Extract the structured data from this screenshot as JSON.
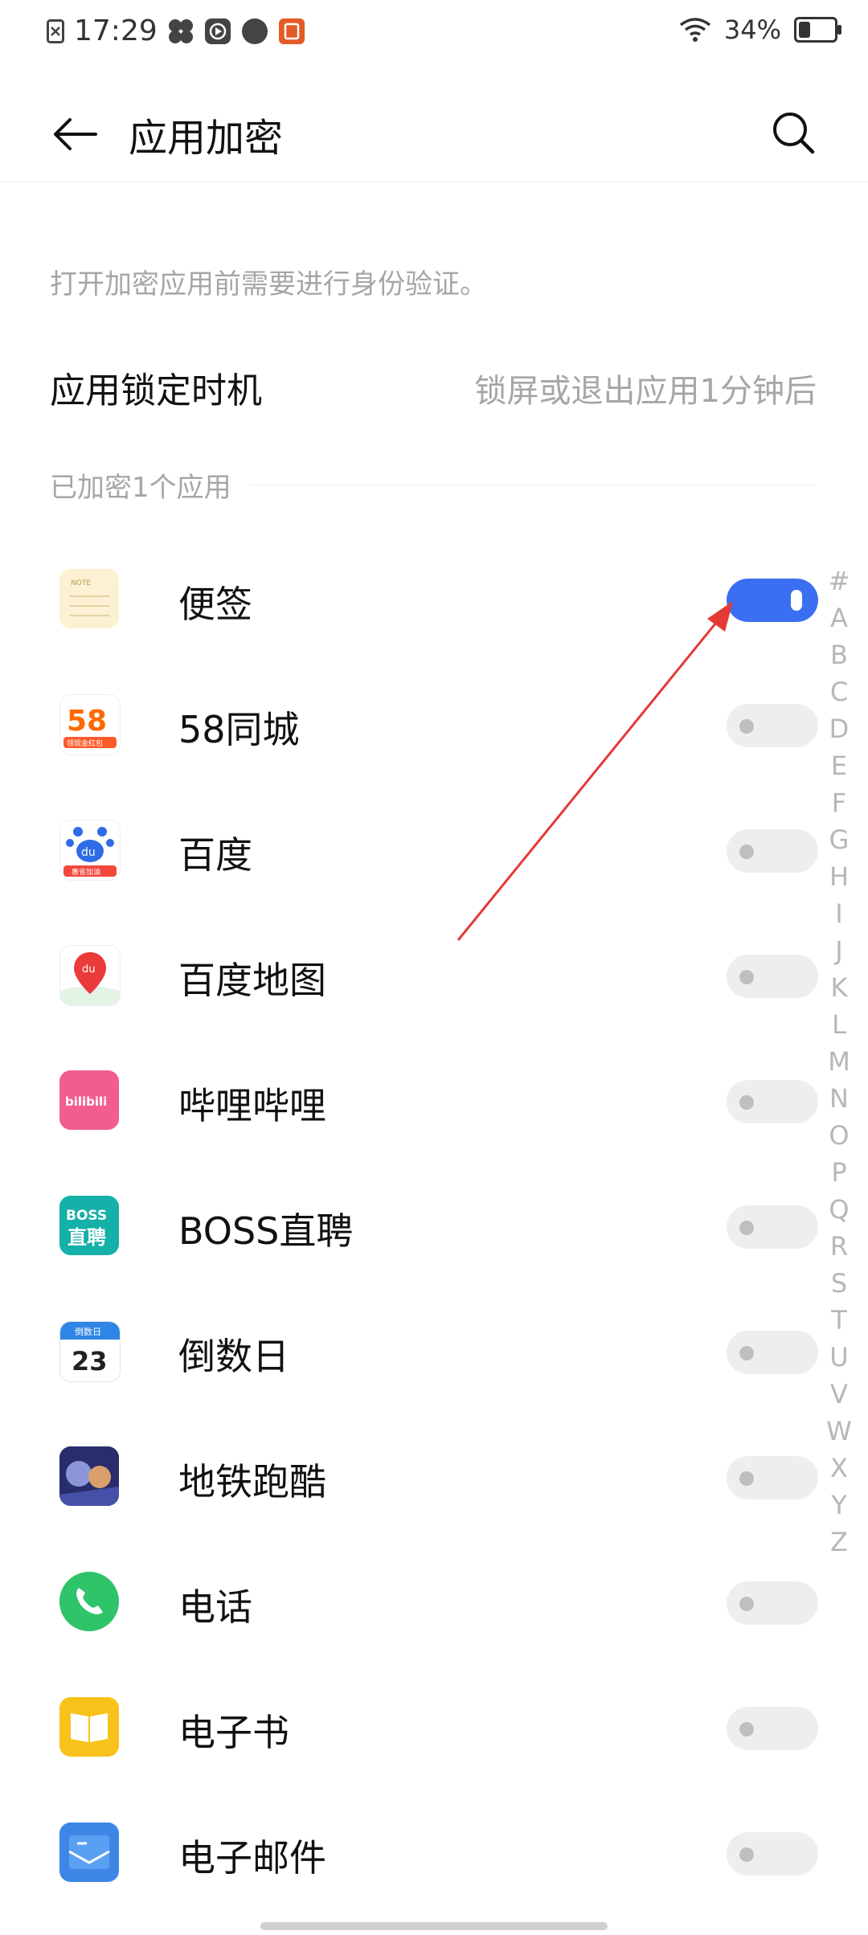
{
  "status_bar": {
    "time": "17:29",
    "battery": "34%",
    "battery_level": 0.34,
    "icons": [
      "sim-icon",
      "pinwheel-icon",
      "video-icon",
      "compass-icon",
      "orange-app-icon",
      "wifi-icon"
    ]
  },
  "header": {
    "title": "应用加密"
  },
  "description": "打开加密应用前需要进行身份验证。",
  "lock_setting": {
    "label": "应用锁定时机",
    "value": "锁屏或退出应用1分钟后"
  },
  "section": {
    "title": "已加密1个应用"
  },
  "apps": [
    {
      "name": "便签",
      "enabled": true,
      "icon": "note-icon"
    },
    {
      "name": "58同城",
      "enabled": false,
      "icon": "58-icon"
    },
    {
      "name": "百度",
      "enabled": false,
      "icon": "baidu-icon"
    },
    {
      "name": "百度地图",
      "enabled": false,
      "icon": "baidu-map-icon"
    },
    {
      "name": "哔哩哔哩",
      "enabled": false,
      "icon": "bilibili-icon"
    },
    {
      "name": "BOSS直聘",
      "enabled": false,
      "icon": "boss-icon"
    },
    {
      "name": "倒数日",
      "enabled": false,
      "icon": "countdown-icon"
    },
    {
      "name": "地铁跑酷",
      "enabled": false,
      "icon": "subway-surfers-icon"
    },
    {
      "name": "电话",
      "enabled": false,
      "icon": "phone-icon"
    },
    {
      "name": "电子书",
      "enabled": false,
      "icon": "ebook-icon"
    },
    {
      "name": "电子邮件",
      "enabled": false,
      "icon": "email-icon"
    }
  ],
  "icon_text": {
    "note": "NOTE",
    "n58": "58",
    "n58_sub": "领现金红包",
    "baidu_du": "du",
    "baidu_sub": "惠省加油",
    "map_du": "du",
    "bili": "bilibili",
    "boss_top": "BOSS",
    "boss_bottom": "直聘",
    "countdown_top": "倒数日",
    "countdown_num": "23"
  },
  "alphabet": [
    "#",
    "A",
    "B",
    "C",
    "D",
    "E",
    "F",
    "G",
    "H",
    "I",
    "J",
    "K",
    "L",
    "M",
    "N",
    "O",
    "P",
    "Q",
    "R",
    "S",
    "T",
    "U",
    "V",
    "W",
    "X",
    "Y",
    "Z"
  ],
  "colors": {
    "accent": "#3a6ff2",
    "annotation": "#e53935",
    "muted_text": "#a6a6a6"
  }
}
